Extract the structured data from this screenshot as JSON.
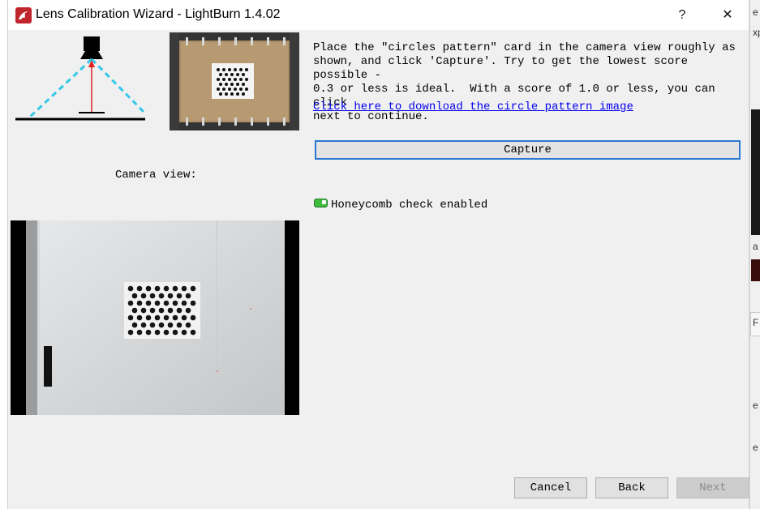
{
  "window": {
    "title": "Lens Calibration Wizard - LightBurn 1.4.02",
    "help_label": "?",
    "close_label": "✕"
  },
  "instructions": {
    "text": "Place the \"circles pattern\" card in the camera view roughly as\nshown, and click 'Capture'. Try to get the lowest score possible -\n0.3 or less is ideal.  With a score of 1.0 or less, you can click\nnext to continue.",
    "download_link": "Click here to download the circle pattern image"
  },
  "capture": {
    "label": "Capture"
  },
  "camera": {
    "label": "Camera view:"
  },
  "honeycomb": {
    "label": "Honeycomb check enabled",
    "enabled": true
  },
  "footer": {
    "cancel_label": "Cancel",
    "back_label": "Back",
    "next_label": "Next"
  },
  "background_app": {
    "fragments": [
      "e",
      "xp",
      "a",
      "F",
      "e",
      "e"
    ]
  },
  "colors": {
    "accent": "#2a78d2",
    "link": "#0000ee",
    "toggle_on": "#3dbb3d",
    "brand": "#c0252b",
    "diagram_beam": "#33c8e8",
    "diagram_arrow": "#e02020"
  },
  "icons": {
    "app": "lightburn-logo-icon",
    "help": "help-icon",
    "close": "close-icon",
    "toggle": "toggle-on-icon"
  }
}
